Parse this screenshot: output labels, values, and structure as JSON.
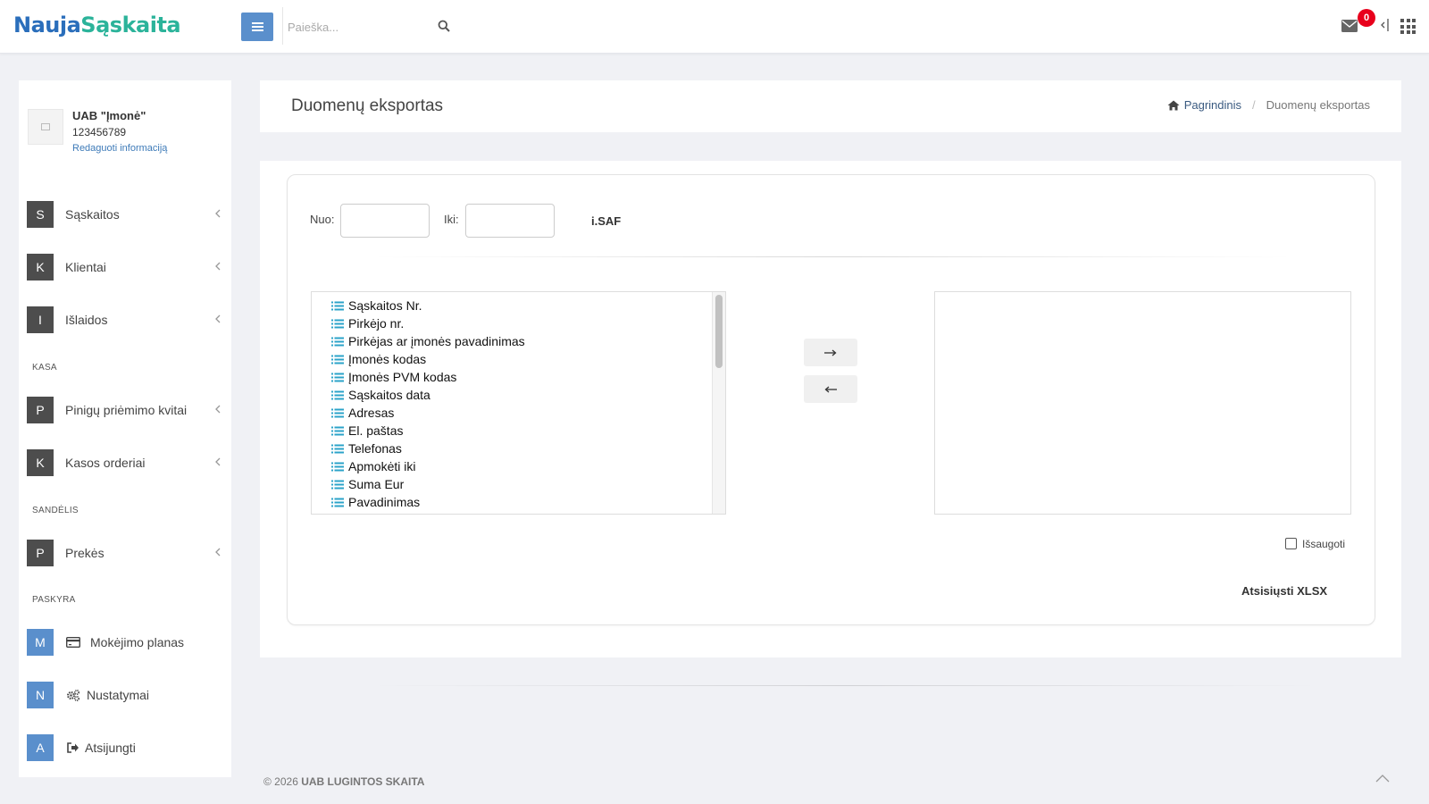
{
  "header": {
    "logo_part1": "Nauja",
    "logo_part2": "Sąskaita",
    "search_placeholder": "Paieška...",
    "notifications_count": "0"
  },
  "profile": {
    "company_name": "UAB \"Įmonė\"",
    "company_code": "123456789",
    "edit_link": "Redaguoti informaciją"
  },
  "sidebar": {
    "items": [
      {
        "letter": "S",
        "label": "Sąskaitos"
      },
      {
        "letter": "K",
        "label": "Klientai"
      },
      {
        "letter": "I",
        "label": "Išlaidos"
      },
      {
        "letter": "P",
        "label": "Pinigų priėmimo kvitai"
      },
      {
        "letter": "K",
        "label": "Kasos orderiai"
      },
      {
        "letter": "P",
        "label": "Prekės"
      },
      {
        "letter": "M",
        "label": "Mokėjimo planas",
        "icon": "credit-card-icon"
      },
      {
        "letter": "N",
        "label": "Nustatymai",
        "icon": "cogs-icon"
      },
      {
        "letter": "A",
        "label": "Atsijungti",
        "icon": "sign-out-icon"
      }
    ],
    "sections": {
      "kasa": "KASA",
      "sandelis": "SANDĖLIS",
      "paskyra": "PASKYRA"
    }
  },
  "page": {
    "title": "Duomenų eksportas",
    "breadcrumb_home": "Pagrindinis",
    "breadcrumb_current": "Duomenų eksportas"
  },
  "export": {
    "from_label": "Nuo:",
    "to_label": "Iki:",
    "from_value": "",
    "to_value": "",
    "isaf_button": "i.SAF",
    "fields": [
      "Sąskaitos Nr.",
      "Pirkėjo nr.",
      "Pirkėjas ar įmonės pavadinimas",
      "Įmonės kodas",
      "Įmonės PVM kodas",
      "Sąskaitos data",
      "Adresas",
      "El. paštas",
      "Telefonas",
      "Apmokėti iki",
      "Suma Eur",
      "Pavadinimas"
    ],
    "move_right_icon": "arrow-right-icon",
    "move_left_icon": "arrow-left-icon",
    "save_label": "Išsaugoti",
    "download_button": "Atsisiųsti XLSX"
  },
  "footer": {
    "copyright": "© 2026",
    "company": "UAB LUGINTOS SKAITA"
  },
  "colors": {
    "brand_blue": "#2a6ebb",
    "brand_teal": "#2bb39a",
    "accent_button": "#5a8fcc",
    "badge_red": "#e8001c",
    "list_icon": "#2ba3c9"
  }
}
